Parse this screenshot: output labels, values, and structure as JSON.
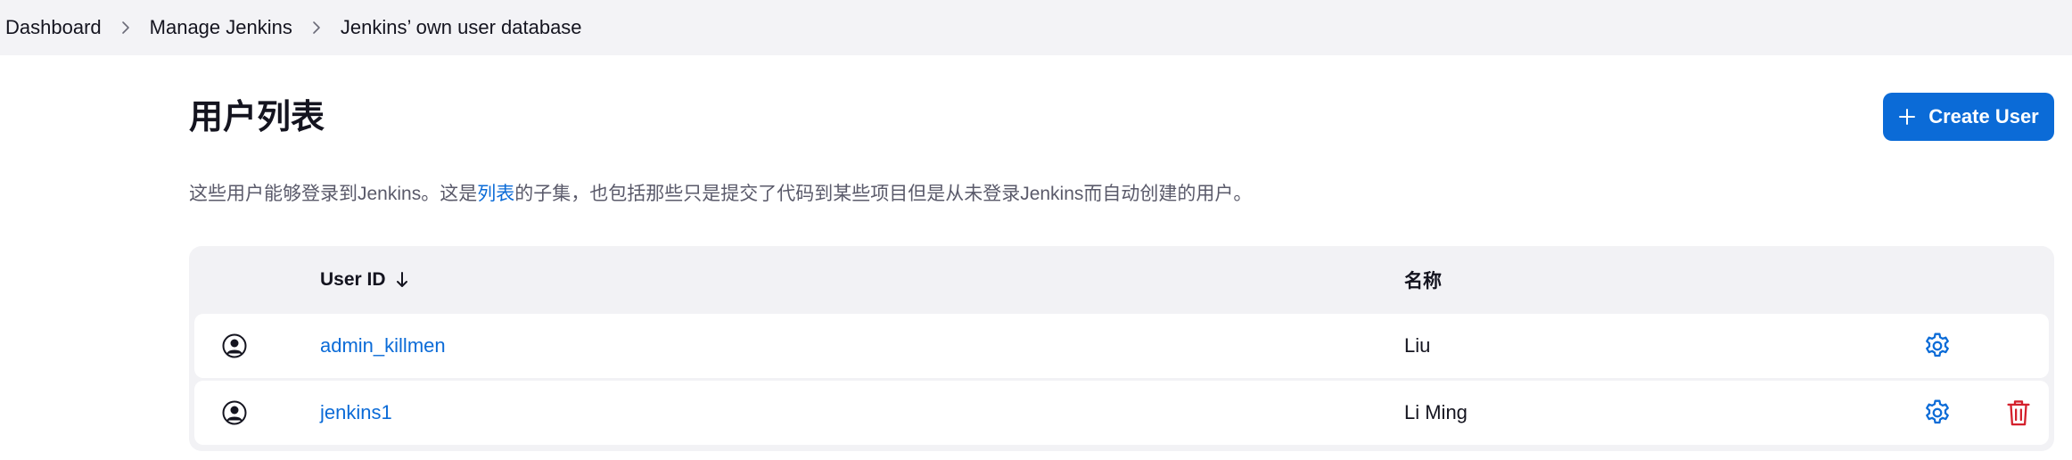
{
  "breadcrumb": {
    "items": [
      {
        "label": "Dashboard"
      },
      {
        "label": "Manage Jenkins"
      },
      {
        "label": "Jenkins’ own user database"
      }
    ]
  },
  "header": {
    "title": "用户列表",
    "create_button_label": "Create User"
  },
  "description": {
    "before": "这些用户能够登录到Jenkins。这是",
    "link": "列表",
    "after": "的子集，也包括那些只是提交了代码到某些项目但是从未登录Jenkins而自动创建的用户。"
  },
  "table": {
    "columns": {
      "user_id": "User ID",
      "name": "名称"
    },
    "sort": {
      "column": "user_id",
      "direction": "descending-arrow"
    },
    "rows": [
      {
        "user_id": "admin_killmen",
        "name": "Liu",
        "deletable": false
      },
      {
        "user_id": "jenkins1",
        "name": "Li Ming",
        "deletable": true
      }
    ]
  },
  "icons": {
    "breadcrumb_separator": "chevron-right-icon",
    "create": "plus-icon",
    "sort": "arrow-down-icon",
    "avatar": "user-circle-icon",
    "configure": "gear-icon",
    "delete": "trash-icon"
  },
  "colors": {
    "accent": "#0b6bd7",
    "danger": "#d4202c",
    "breadcrumb_bg": "#f3f3f6",
    "table_bg": "#f2f2f5",
    "text": "#14141f",
    "muted_text": "#5a5a6a"
  }
}
